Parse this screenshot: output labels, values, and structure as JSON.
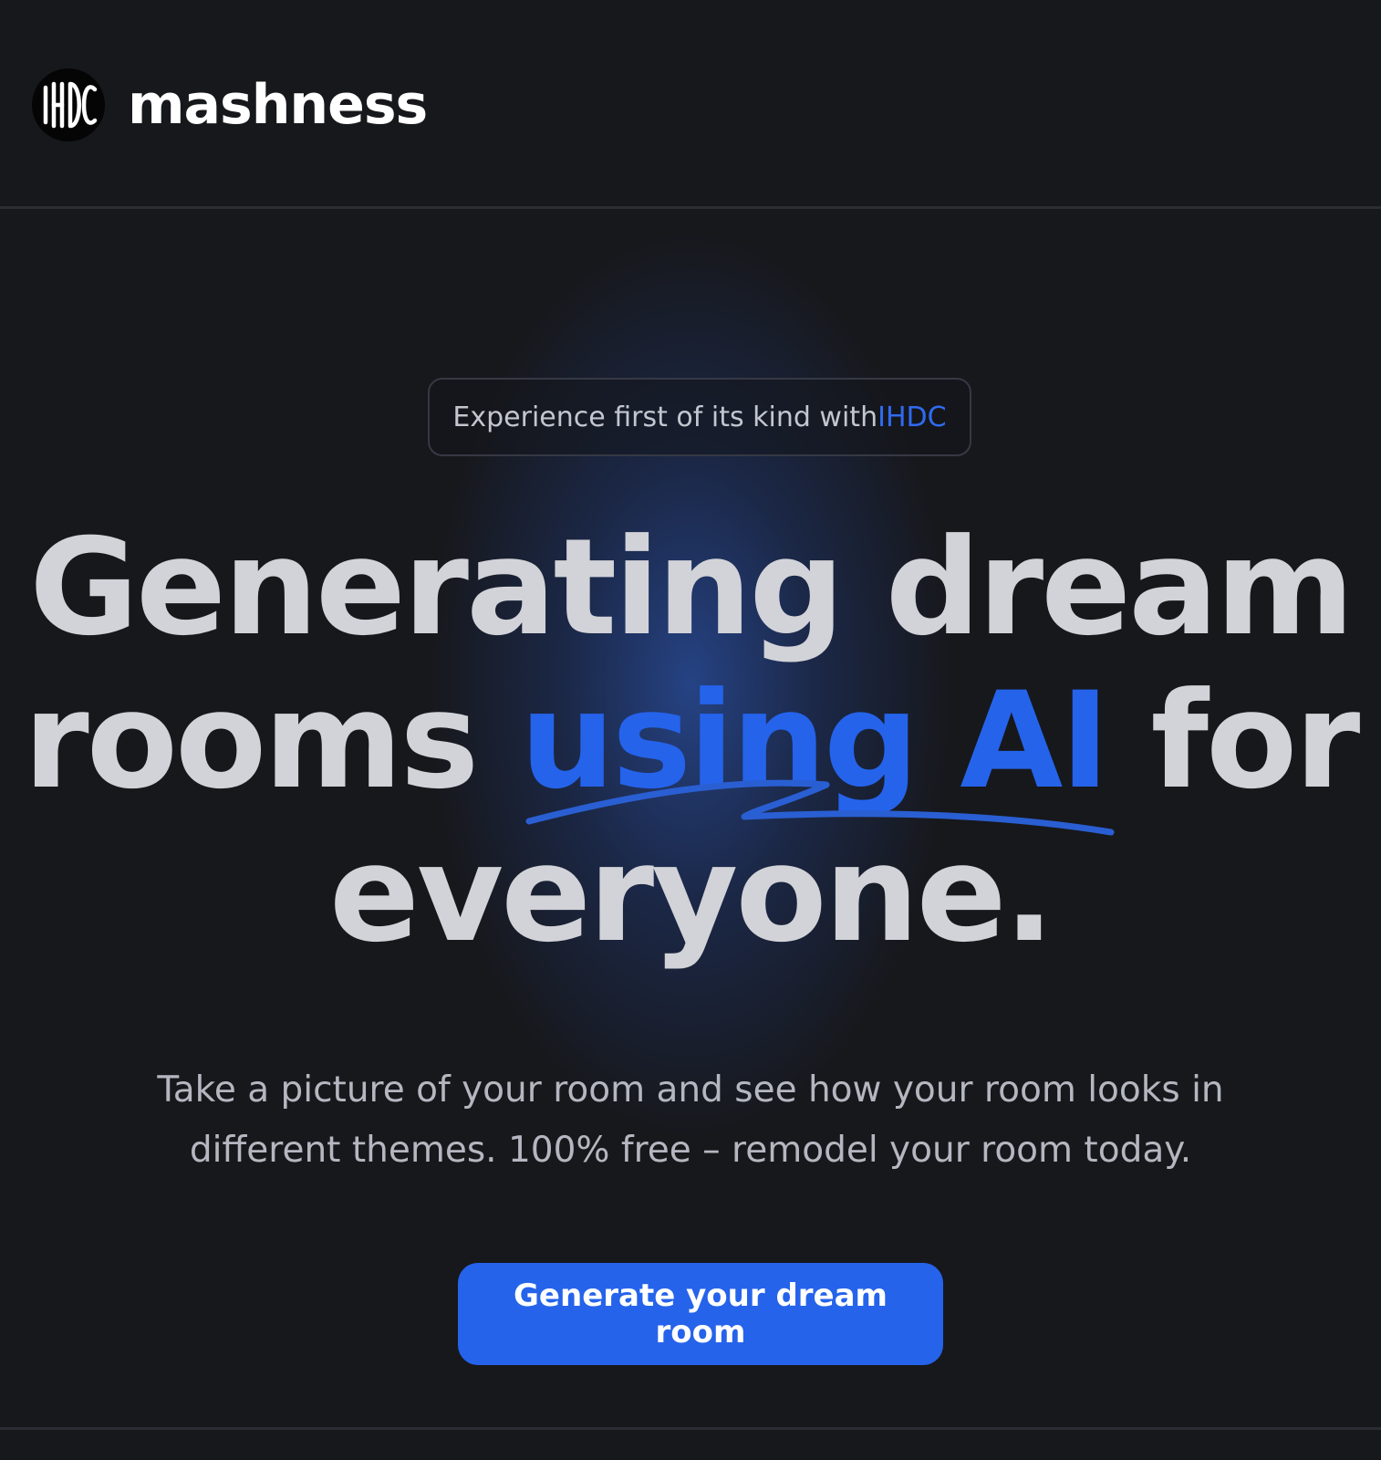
{
  "header": {
    "brand_name": "mashness",
    "logo_text": "IHDC"
  },
  "hero": {
    "tag_text": "Experience first of its kind with ",
    "tag_accent": "IHDC",
    "headline_part1": "Generating dream rooms ",
    "headline_highlight": "using AI",
    "headline_part2": " for everyone.",
    "subtitle": "Take a picture of your room and see how your room looks in different themes. 100% free – remodel your room today.",
    "cta_label": "Generate your dream room"
  },
  "colors": {
    "background": "#17181c",
    "accent": "#2563eb",
    "text": "#d2d3d8"
  }
}
